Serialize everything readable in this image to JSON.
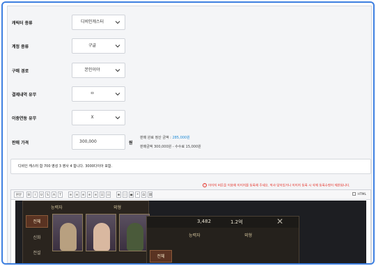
{
  "form": {
    "character_type": {
      "label": "캐릭터 종류",
      "value": "디비인캐스터"
    },
    "account_type": {
      "label": "계정 종류",
      "value": "구글"
    },
    "purchase_route": {
      "label": "구매 경로",
      "value": "본인이야"
    },
    "payment_history": {
      "label": "결제내역 유무",
      "value": "ㅁ"
    },
    "linked_id": {
      "label": "이중연동 유무",
      "value": "X"
    },
    "sale_price": {
      "label": "판매 가격",
      "value": "300,000",
      "unit": "원",
      "settlement_label": "판매 완료 정산 금액 : ",
      "settlement_value": "285,000원",
      "fee_text": "판매금액 300,000원 - 수수료 15,000원"
    }
  },
  "description": "디비인 캐스터 합 700 영성 3 영사 4 합니다. 3000다이아 포함.",
  "notice": "이미지 버튼을 이용해 이미지를 등록해 주세요. 작사·닿아있거나 이미지 등록 시 삭제 등록수정이 제한됩니다.",
  "editor": {
    "toolbar": [
      "B",
      "I",
      "U",
      "S",
      "A",
      "T",
      "≡",
      "≡",
      "≡",
      "≡",
      "≡",
      "☰",
      "☷",
      "⊞",
      "ⓘ",
      "▣",
      "❝",
      "Ω",
      "⛓"
    ],
    "html_label": "HTML"
  },
  "game": {
    "left_tabs": [
      "능력자",
      "외형"
    ],
    "left_sidebar": [
      "전체",
      "신화",
      "전설"
    ],
    "right_stats": [
      "3,482",
      "1.2억"
    ],
    "right_tabs": [
      "능력자",
      "외형"
    ],
    "right_sidebar": [
      "전체"
    ]
  },
  "colors": {
    "accent": "#3d7fe0",
    "settlement": "#1e8ad6",
    "notice": "#e5332a"
  }
}
